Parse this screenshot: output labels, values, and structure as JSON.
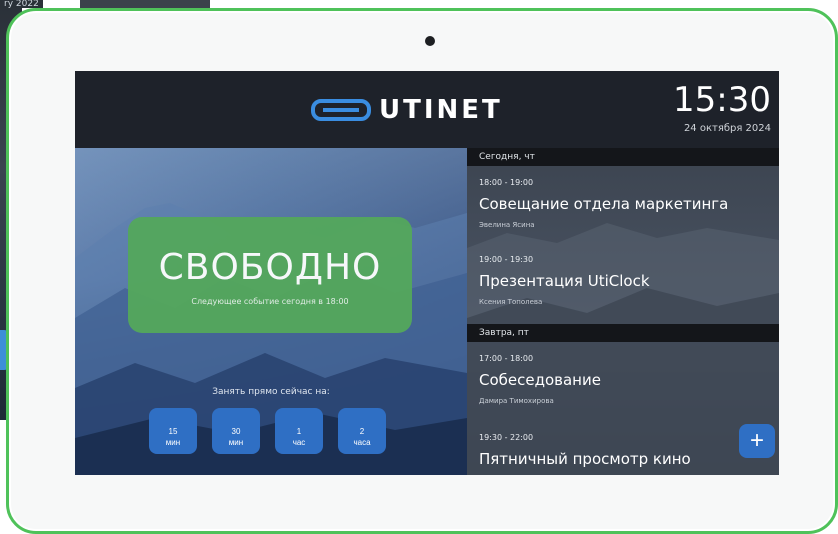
{
  "background": {
    "top_text": "ry 2022"
  },
  "header": {
    "logo_text": "UTINET",
    "time": "15:30",
    "date": "24 октября 2024"
  },
  "status": {
    "title": "СВОБОДНО",
    "subtitle": "Следующее событие сегодня в 18:00"
  },
  "booking": {
    "label": "Занять прямо сейчас на:",
    "buttons": [
      {
        "line1": "15",
        "line2": "мин"
      },
      {
        "line1": "30",
        "line2": "мин"
      },
      {
        "line1": "1",
        "line2": "час"
      },
      {
        "line1": "2",
        "line2": "часа"
      }
    ]
  },
  "schedule": {
    "days": [
      {
        "label": "Сегодня, чт"
      },
      {
        "label": "Завтра, пт"
      }
    ],
    "events": [
      {
        "time": "18:00 - 19:00",
        "title": "Совещание отдела маркетинга",
        "person": "Эвелина Ясина"
      },
      {
        "time": "19:00 - 19:30",
        "title": "Презентация UtiClock",
        "person": "Ксения Тополева"
      },
      {
        "time": "17:00 - 18:00",
        "title": "Собеседование",
        "person": "Дамира Тимохирова"
      },
      {
        "time": "19:30 - 22:00",
        "title": "Пятничный просмотр кино",
        "person": ""
      }
    ],
    "add_label": "+"
  },
  "colors": {
    "free_status": "#54a85c",
    "accent_blue": "#2f6fc4",
    "logo_blue": "#3a8de0",
    "device_border": "#4fc25a"
  },
  "icons": {
    "add": "plus-icon",
    "logo": "utinet-logo-icon"
  }
}
